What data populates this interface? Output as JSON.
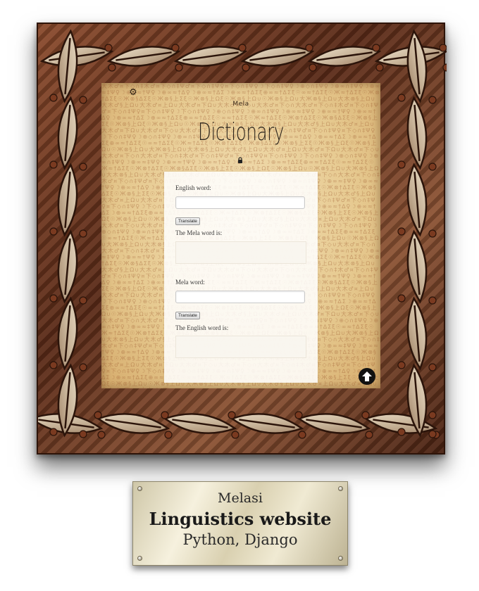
{
  "site": {
    "subtitle": "Mela",
    "title": "Dictionary"
  },
  "icons": {
    "settings": "gear-icon",
    "lock": "lock-icon",
    "scroll_up": "arrow-up-circle-icon"
  },
  "english_to_mela": {
    "input_label": "English word:",
    "input_value": "",
    "button_label": "Translate",
    "result_label": "The Mela word is:",
    "result_value": ""
  },
  "mela_to_english": {
    "input_label": "Mela word:",
    "input_value": "",
    "button_label": "Translate",
    "result_label": "The English word is:",
    "result_value": ""
  },
  "plaque": {
    "line1": "Melasi",
    "line2": "Linguistics website",
    "line3": "Python, Django"
  },
  "colors": {
    "frame_wood": "#6b3520",
    "parchment": "#e8cc95",
    "plaque_brass": "#e6dfc4"
  }
}
